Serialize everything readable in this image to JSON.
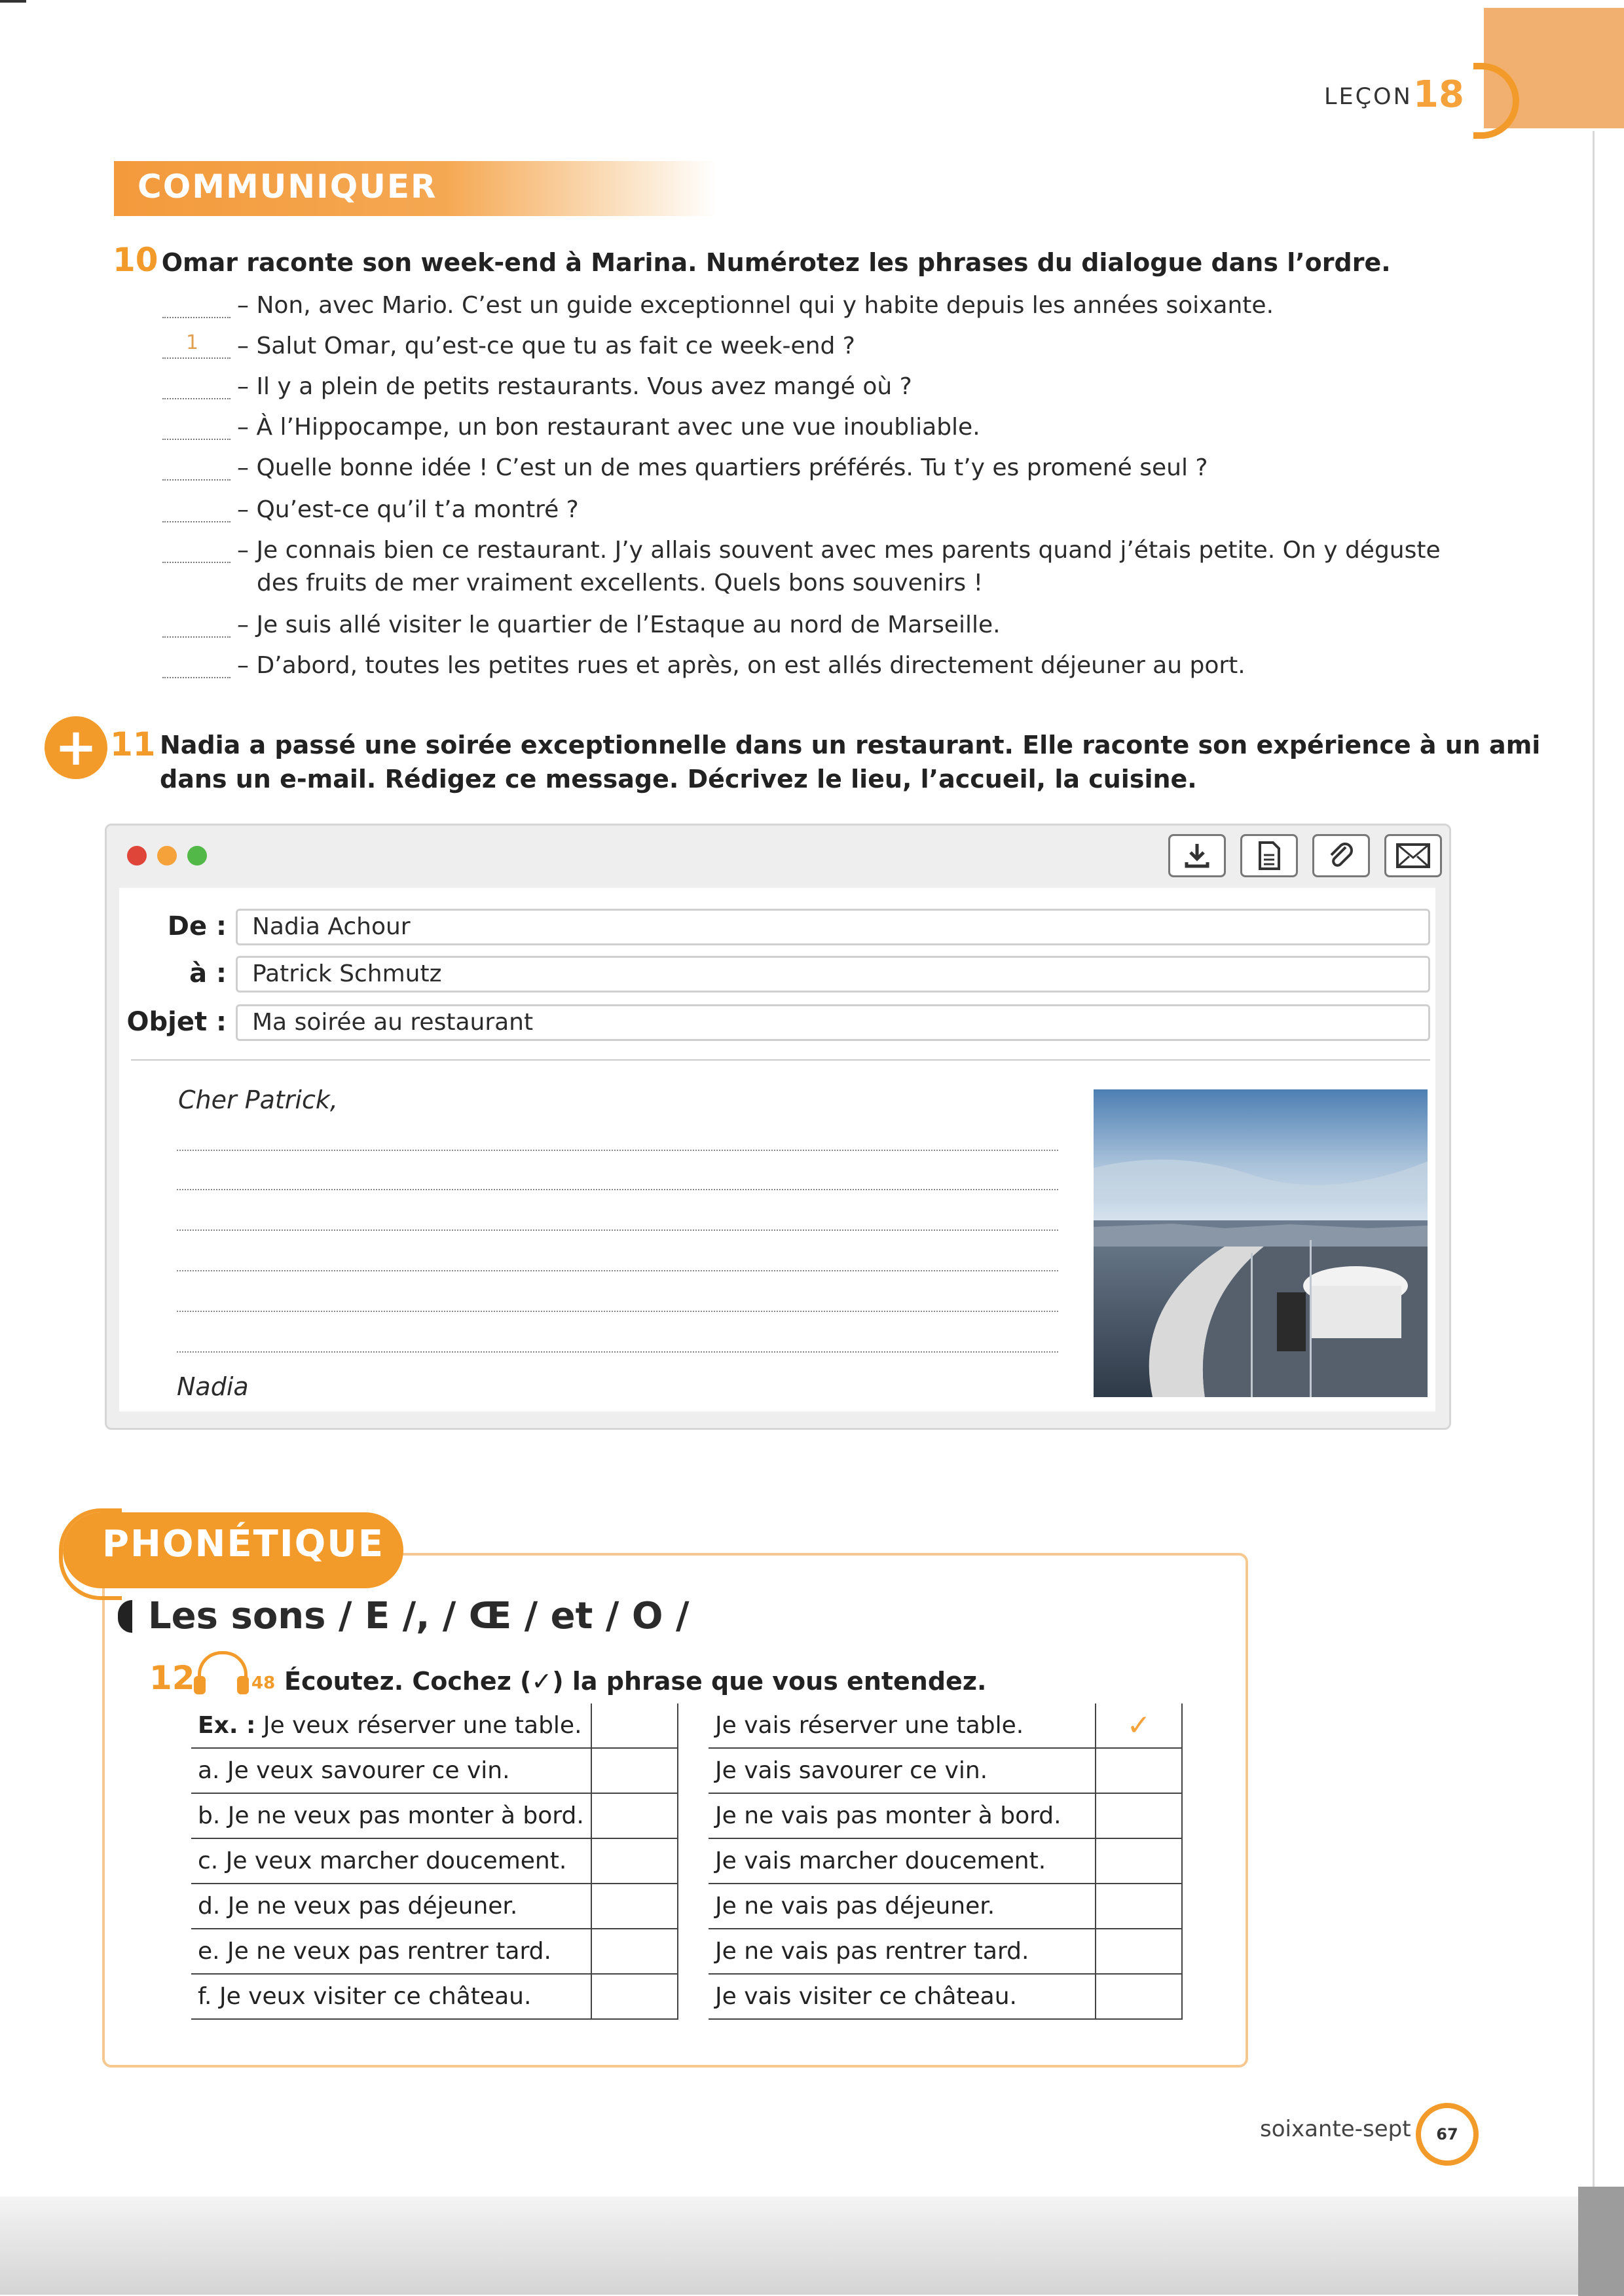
{
  "header": {
    "lecon_label": "LEÇON",
    "lecon_number": "18"
  },
  "section1": {
    "title": "COMMUNIQUER"
  },
  "ex10": {
    "number": "10",
    "instruction": "Omar raconte son week-end à Marina. Numérotez les phrases du dialogue dans l’ordre.",
    "lines": [
      {
        "answer": "",
        "text": "– Non, avec Mario. C’est un guide exceptionnel qui y habite depuis les années soixante."
      },
      {
        "answer": "1",
        "text": "– Salut Omar, qu’est-ce que tu as fait ce week-end ?"
      },
      {
        "answer": "",
        "text": "– Il y a plein de petits restaurants. Vous avez mangé où ?"
      },
      {
        "answer": "",
        "text": "– À l’Hippocampe, un bon restaurant avec une vue inoubliable."
      },
      {
        "answer": "",
        "text": "– Quelle bonne idée ! C’est un de mes quartiers préférés. Tu t’y es promené seul ?"
      },
      {
        "answer": "",
        "text": "– Qu’est-ce qu’il t’a montré ?"
      },
      {
        "answer": "",
        "text": "– Je connais bien ce restaurant. J’y allais souvent avec mes parents quand j’étais petite. On y déguste"
      },
      {
        "answer": "",
        "text": "des fruits de mer vraiment excellents. Quels bons souvenirs !"
      },
      {
        "answer": "",
        "text": "– Je suis allé visiter le quartier de l’Estaque au nord de Marseille."
      },
      {
        "answer": "",
        "text": "– D’abord, toutes les petites rues et après, on est allés directement déjeuner au port."
      }
    ]
  },
  "ex11": {
    "plus": "+",
    "number": "11",
    "instruction_line1": "Nadia a passé une soirée exceptionnelle dans un restaurant. Elle raconte son expérience à un ami",
    "instruction_line2": "dans un e-mail. Rédigez ce message. Décrivez le lieu, l’accueil, la cuisine."
  },
  "email": {
    "from_label": "De :",
    "from_value": "Nadia Achour",
    "to_label": "à :",
    "to_value": "Patrick Schmutz",
    "subject_label": "Objet :",
    "subject_value": "Ma soirée au restaurant",
    "greeting": "Cher Patrick,",
    "signature": "Nadia",
    "toolbar_icons": [
      "download-icon",
      "document-icon",
      "attachment-icon",
      "envelope-icon"
    ],
    "dot_colors": [
      "#e0453a",
      "#f5a23a",
      "#52b848"
    ]
  },
  "phonetique": {
    "title": "PHONÉTIQUE",
    "subtitle": "Les sons / E /, / Œ / et / O /",
    "ex_number": "12",
    "track": "48",
    "instruction": "Écoutez. Cochez (✓) la phrase que vous entendez.",
    "check": "✓",
    "example_prefix": "Ex. :",
    "rows": [
      {
        "letter": "",
        "left": "Je veux réserver une table.",
        "right": "Je vais réserver une table.",
        "left_checked": false,
        "right_checked": true
      },
      {
        "letter": "a.",
        "left": "Je veux savourer ce vin.",
        "right": "Je vais savourer ce vin.",
        "left_checked": false,
        "right_checked": false
      },
      {
        "letter": "b.",
        "left": "Je ne veux pas monter à bord.",
        "right": "Je ne vais pas monter à bord.",
        "left_checked": false,
        "right_checked": false
      },
      {
        "letter": "c.",
        "left": "Je veux marcher doucement.",
        "right": "Je vais marcher doucement.",
        "left_checked": false,
        "right_checked": false
      },
      {
        "letter": "d.",
        "left": "Je ne veux pas déjeuner.",
        "right": "Je ne vais pas déjeuner.",
        "left_checked": false,
        "right_checked": false
      },
      {
        "letter": "e.",
        "left": "Je ne veux pas rentrer tard.",
        "right": "Je ne vais pas rentrer tard.",
        "left_checked": false,
        "right_checked": false
      },
      {
        "letter": "f.",
        "left": "Je veux visiter ce château.",
        "right": "Je vais visiter ce château.",
        "left_checked": false,
        "right_checked": false
      }
    ]
  },
  "footer": {
    "page_words": "soixante-sept",
    "page_number": "67"
  },
  "colors": {
    "accent": "#f39b2a",
    "accent_light": "#f6c890"
  }
}
